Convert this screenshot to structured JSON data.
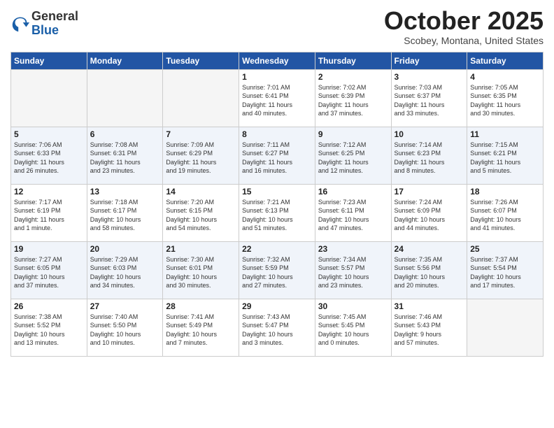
{
  "header": {
    "logo": {
      "general": "General",
      "blue": "Blue"
    },
    "title": "October 2025",
    "location": "Scobey, Montana, United States"
  },
  "weekdays": [
    "Sunday",
    "Monday",
    "Tuesday",
    "Wednesday",
    "Thursday",
    "Friday",
    "Saturday"
  ],
  "weeks": [
    [
      {
        "day": "",
        "info": ""
      },
      {
        "day": "",
        "info": ""
      },
      {
        "day": "",
        "info": ""
      },
      {
        "day": "1",
        "info": "Sunrise: 7:01 AM\nSunset: 6:41 PM\nDaylight: 11 hours\nand 40 minutes."
      },
      {
        "day": "2",
        "info": "Sunrise: 7:02 AM\nSunset: 6:39 PM\nDaylight: 11 hours\nand 37 minutes."
      },
      {
        "day": "3",
        "info": "Sunrise: 7:03 AM\nSunset: 6:37 PM\nDaylight: 11 hours\nand 33 minutes."
      },
      {
        "day": "4",
        "info": "Sunrise: 7:05 AM\nSunset: 6:35 PM\nDaylight: 11 hours\nand 30 minutes."
      }
    ],
    [
      {
        "day": "5",
        "info": "Sunrise: 7:06 AM\nSunset: 6:33 PM\nDaylight: 11 hours\nand 26 minutes."
      },
      {
        "day": "6",
        "info": "Sunrise: 7:08 AM\nSunset: 6:31 PM\nDaylight: 11 hours\nand 23 minutes."
      },
      {
        "day": "7",
        "info": "Sunrise: 7:09 AM\nSunset: 6:29 PM\nDaylight: 11 hours\nand 19 minutes."
      },
      {
        "day": "8",
        "info": "Sunrise: 7:11 AM\nSunset: 6:27 PM\nDaylight: 11 hours\nand 16 minutes."
      },
      {
        "day": "9",
        "info": "Sunrise: 7:12 AM\nSunset: 6:25 PM\nDaylight: 11 hours\nand 12 minutes."
      },
      {
        "day": "10",
        "info": "Sunrise: 7:14 AM\nSunset: 6:23 PM\nDaylight: 11 hours\nand 8 minutes."
      },
      {
        "day": "11",
        "info": "Sunrise: 7:15 AM\nSunset: 6:21 PM\nDaylight: 11 hours\nand 5 minutes."
      }
    ],
    [
      {
        "day": "12",
        "info": "Sunrise: 7:17 AM\nSunset: 6:19 PM\nDaylight: 11 hours\nand 1 minute."
      },
      {
        "day": "13",
        "info": "Sunrise: 7:18 AM\nSunset: 6:17 PM\nDaylight: 10 hours\nand 58 minutes."
      },
      {
        "day": "14",
        "info": "Sunrise: 7:20 AM\nSunset: 6:15 PM\nDaylight: 10 hours\nand 54 minutes."
      },
      {
        "day": "15",
        "info": "Sunrise: 7:21 AM\nSunset: 6:13 PM\nDaylight: 10 hours\nand 51 minutes."
      },
      {
        "day": "16",
        "info": "Sunrise: 7:23 AM\nSunset: 6:11 PM\nDaylight: 10 hours\nand 47 minutes."
      },
      {
        "day": "17",
        "info": "Sunrise: 7:24 AM\nSunset: 6:09 PM\nDaylight: 10 hours\nand 44 minutes."
      },
      {
        "day": "18",
        "info": "Sunrise: 7:26 AM\nSunset: 6:07 PM\nDaylight: 10 hours\nand 41 minutes."
      }
    ],
    [
      {
        "day": "19",
        "info": "Sunrise: 7:27 AM\nSunset: 6:05 PM\nDaylight: 10 hours\nand 37 minutes."
      },
      {
        "day": "20",
        "info": "Sunrise: 7:29 AM\nSunset: 6:03 PM\nDaylight: 10 hours\nand 34 minutes."
      },
      {
        "day": "21",
        "info": "Sunrise: 7:30 AM\nSunset: 6:01 PM\nDaylight: 10 hours\nand 30 minutes."
      },
      {
        "day": "22",
        "info": "Sunrise: 7:32 AM\nSunset: 5:59 PM\nDaylight: 10 hours\nand 27 minutes."
      },
      {
        "day": "23",
        "info": "Sunrise: 7:34 AM\nSunset: 5:57 PM\nDaylight: 10 hours\nand 23 minutes."
      },
      {
        "day": "24",
        "info": "Sunrise: 7:35 AM\nSunset: 5:56 PM\nDaylight: 10 hours\nand 20 minutes."
      },
      {
        "day": "25",
        "info": "Sunrise: 7:37 AM\nSunset: 5:54 PM\nDaylight: 10 hours\nand 17 minutes."
      }
    ],
    [
      {
        "day": "26",
        "info": "Sunrise: 7:38 AM\nSunset: 5:52 PM\nDaylight: 10 hours\nand 13 minutes."
      },
      {
        "day": "27",
        "info": "Sunrise: 7:40 AM\nSunset: 5:50 PM\nDaylight: 10 hours\nand 10 minutes."
      },
      {
        "day": "28",
        "info": "Sunrise: 7:41 AM\nSunset: 5:49 PM\nDaylight: 10 hours\nand 7 minutes."
      },
      {
        "day": "29",
        "info": "Sunrise: 7:43 AM\nSunset: 5:47 PM\nDaylight: 10 hours\nand 3 minutes."
      },
      {
        "day": "30",
        "info": "Sunrise: 7:45 AM\nSunset: 5:45 PM\nDaylight: 10 hours\nand 0 minutes."
      },
      {
        "day": "31",
        "info": "Sunrise: 7:46 AM\nSunset: 5:43 PM\nDaylight: 9 hours\nand 57 minutes."
      },
      {
        "day": "",
        "info": ""
      }
    ]
  ]
}
